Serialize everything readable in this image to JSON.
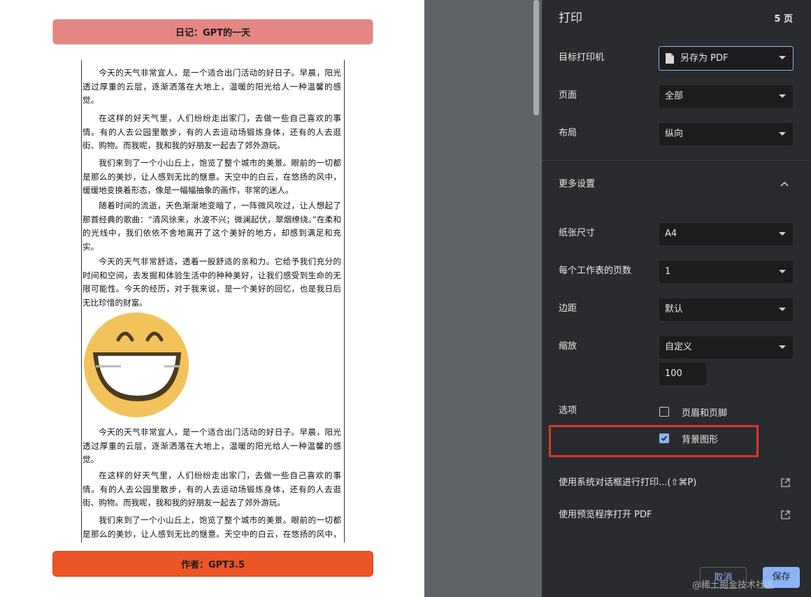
{
  "document": {
    "header": "日记：GPT的一天",
    "footer": "作者：GPT3.5",
    "paragraphs": [
      "今天的天气非常宜人，是一个适合出门活动的好日子。早晨，阳光透过厚重的云层，逐渐洒落在大地上，温暖的阳光给人一种温馨的感觉。",
      "在这样的好天气里，人们纷纷走出家门，去做一些自己喜欢的事情。有的人去公园里散步，有的人去运动场锻炼身体，还有的人去逛街、购物。而我呢，我和我的好朋友一起去了郊外游玩。",
      "我们来到了一个小山丘上，饱览了整个城市的美景。眼前的一切都是那么的美妙，让人感到无比的惬意。天空中的白云，在悠扬的风中，缓缓地变换着形态，像是一幅幅抽象的画作，非常的迷人。",
      "随着时间的流逝，天色渐渐地变暗了，一阵微风吹过，让人想起了那首经典的歌曲：“清风徐来，水波不兴；微澜起伏，翠烟缭绕。”在柔和的光线中，我们依依不舍地离开了这个美好的地方，却感到满足和充实。",
      "今天的天气非常舒适，透着一股舒适的亲和力。它给予我们充分的时间和空间，去发掘和体验生活中的种种美好，让我们感受到生命的无限可能性。今天的经历，对于我来说，是一个美好的回忆，也是我日后无比珍惜的财富。",
      "今天的天气非常宜人，是一个适合出门活动的好日子。早晨，阳光透过厚重的云层，逐渐洒落在大地上，温暖的阳光给人一种温馨的感觉。",
      "在这样的好天气里，人们纷纷走出家门，去做一些自己喜欢的事情。有的人去公园里散步，有的人去运动场锻炼身体，还有的人去逛街、购物。而我呢，我和我的好朋友一起去了郊外游玩。",
      "我们来到了一个小山丘上，饱览了整个城市的美景。眼前的一切都是那么的美妙，让人感到无比的惬意。天空中的白云，在悠扬的风中，缓缓地变换着形态，像是一幅幅抽象的画作，非常的迷人。"
    ]
  },
  "dialog": {
    "title": "打印",
    "page_count": "5 页",
    "destination": {
      "label": "目标打印机",
      "value": "另存为 PDF"
    },
    "pages": {
      "label": "页面",
      "value": "全部"
    },
    "layout": {
      "label": "布局",
      "value": "纵向"
    },
    "more_settings": "更多设置",
    "paper_size": {
      "label": "纸张尺寸",
      "value": "A4"
    },
    "pages_per_sheet": {
      "label": "每个工作表的页数",
      "value": "1"
    },
    "margins": {
      "label": "边距",
      "value": "默认"
    },
    "scale": {
      "label": "缩放",
      "value": "自定义",
      "custom_value": "100"
    },
    "options": {
      "label": "选项",
      "headers_footers": {
        "label": "页眉和页脚",
        "checked": false
      },
      "background_graphics": {
        "label": "背景图形",
        "checked": true
      }
    },
    "system_dialog_link": "使用系统对话框进行打印...(⇧⌘P)",
    "open_in_preview_link": "使用预览程序打开 PDF",
    "cancel_label": "取消",
    "save_label": "保存"
  },
  "watermark": "@稀土掘金技术社区",
  "colors": {
    "header_banner": "#e58682",
    "footer_banner": "#ec5527",
    "dialog_bg": "#2a2b2e",
    "accent": "#8ab4f8",
    "highlight": "#d8362b"
  }
}
